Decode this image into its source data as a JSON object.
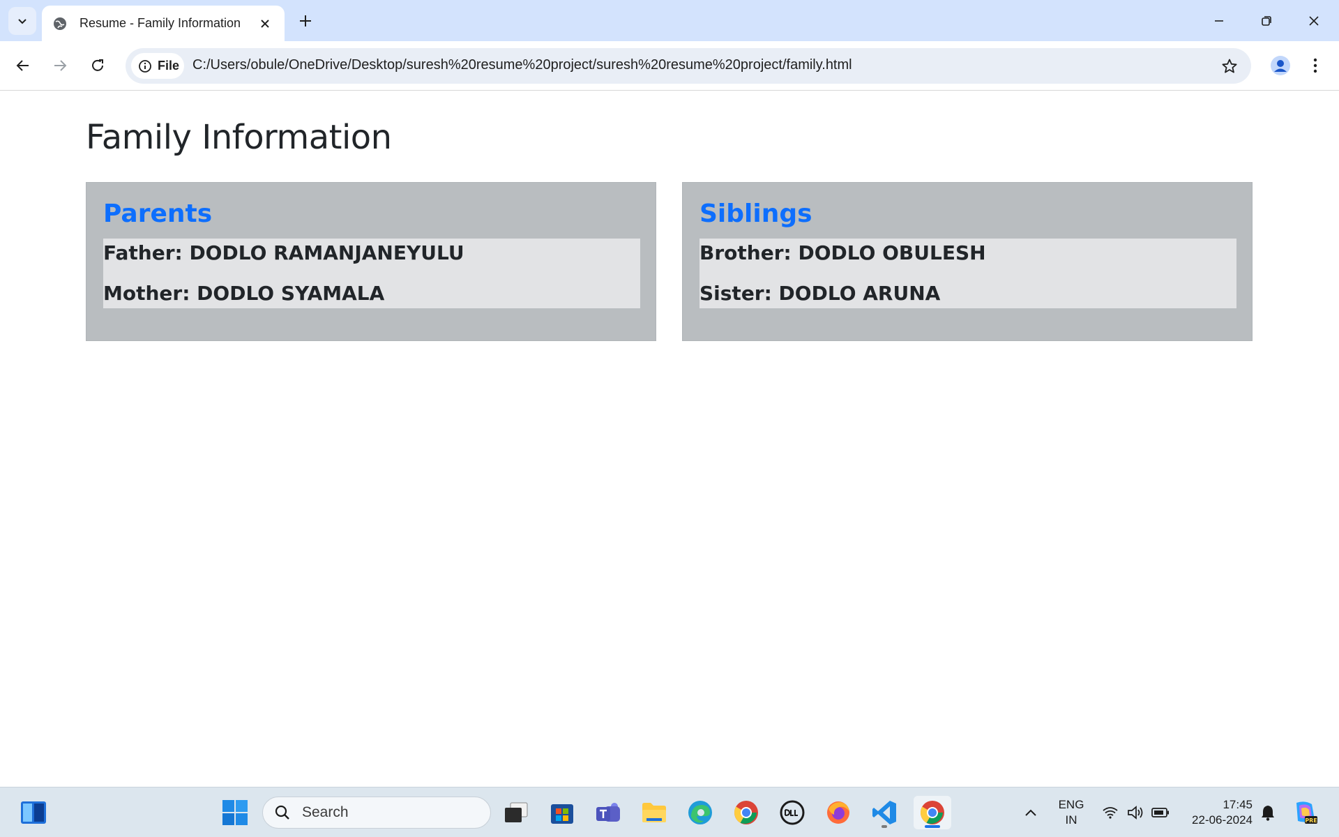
{
  "browser": {
    "tab_title": "Resume - Family Information",
    "site_chip_label": "File",
    "url": "C:/Users/obule/OneDrive/Desktop/suresh%20resume%20project/suresh%20resume%20project/family.html"
  },
  "page": {
    "title": "Family Information",
    "cards": [
      {
        "heading": "Parents",
        "items": [
          "Father: DODLO RAMANJANEYULU",
          "Mother: DODLO SYAMALA"
        ]
      },
      {
        "heading": "Siblings",
        "items": [
          "Brother: DODLO OBULESH",
          "Sister: DODLO ARUNA"
        ]
      }
    ]
  },
  "taskbar": {
    "search_label": "Search",
    "icons": [
      "widgets-icon",
      "start-icon",
      "task-view-icon",
      "store-icon",
      "teams-icon",
      "file-explorer-icon",
      "edge-icon",
      "chrome-icon",
      "dell-icon",
      "firefox-icon",
      "vscode-icon",
      "chrome-active-icon"
    ],
    "language_line1": "ENG",
    "language_line2": "IN",
    "time": "17:45",
    "date": "22-06-2024"
  },
  "colors": {
    "tabstrip": "#d3e3fd",
    "card_bg": "#b9bdc0",
    "card_list_bg": "#e2e3e5",
    "heading_blue": "#0d6efd"
  }
}
